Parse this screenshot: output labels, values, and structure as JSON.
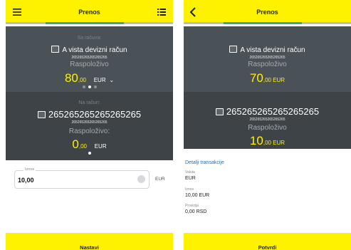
{
  "screen1": {
    "title": "Prenos",
    "from_label": "Sa računa:",
    "from_account_name": "A vista devizni račun",
    "from_account_number": "265265265265265265",
    "available_label": "Raspoloživo",
    "amount_int": "80",
    "amount_dec": ",00",
    "currency": "EUR",
    "to_label": "Na račun:",
    "to_account_name": "265265265265265265",
    "to_account_number": "265265265265265265",
    "to_available_label": "Raspoloživo:",
    "to_amount_int": "0",
    "to_amount_dec": ",00",
    "to_currency": "EUR",
    "input_label": "Iznos",
    "input_value": "10,00",
    "input_currency": "EUR",
    "cta": "Nastavi"
  },
  "screen2": {
    "title": "Prenos",
    "from_account_name": "A vista devizni račun",
    "from_account_number": "265265265265265265",
    "available_label": "Raspoloživo",
    "amount_int": "70",
    "amount_dec": ",00 EUR",
    "to_account_name": "265265265265265265",
    "to_account_number": "265265265265265265",
    "to_available_label": "Raspoloživo",
    "to_amount_int": "10",
    "to_amount_dec": ",00 EUR",
    "details_title": "Detalji transakcije",
    "details": [
      {
        "label": "Valuta",
        "value": "EUR"
      },
      {
        "label": "Iznos",
        "value": "10,00 EUR"
      },
      {
        "label": "Provizija",
        "value": "0,00 RSD"
      }
    ],
    "cta": "Potvrdi"
  },
  "colors": {
    "accent_yellow": "#fff200",
    "panel_dark": "#3d4347",
    "panel_mid": "#4a5157",
    "tab_accent": "#2ea9a0",
    "link_blue": "#1f6fb6"
  }
}
